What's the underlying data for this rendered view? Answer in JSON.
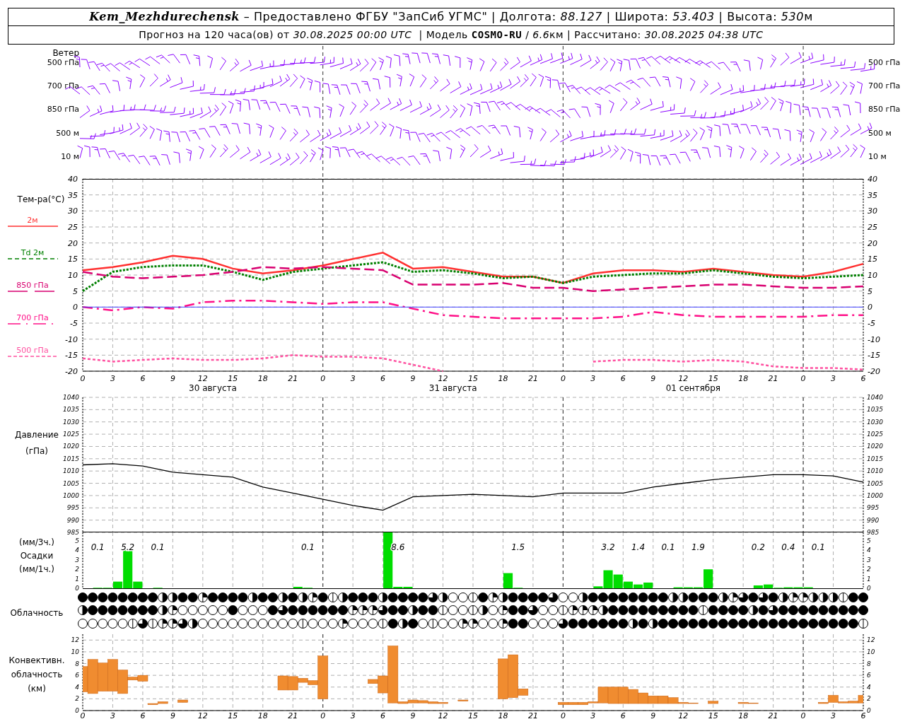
{
  "header": {
    "line_1": [
      {
        "text": "Kem_Mezhdurechensk",
        "kind": "station"
      },
      {
        "text": " – Предоставлено ФГБУ \"ЗапСиб УГМС\" | Долгота: ",
        "kind": "plain"
      },
      {
        "text": "88.127",
        "kind": "italic"
      },
      {
        "text": " | Широта: ",
        "kind": "plain"
      },
      {
        "text": "53.403",
        "kind": "italic"
      },
      {
        "text": " | Высота: ",
        "kind": "plain"
      },
      {
        "text": "530",
        "kind": "italic"
      },
      {
        "text": "м",
        "kind": "plain"
      }
    ],
    "line_2": [
      {
        "text": "Прогноз на 120 часа(ов) от ",
        "kind": "plain"
      },
      {
        "text": "30.08.2025 00:00 UTC",
        "kind": "italic"
      },
      {
        "text": "  | Модель ",
        "kind": "plain"
      },
      {
        "text": "COSMO-RU",
        "kind": "bold"
      },
      {
        "text": " / ",
        "kind": "plain"
      },
      {
        "text": "6.6",
        "kind": "italic"
      },
      {
        "text": "км | Рассчитано: ",
        "kind": "plain"
      },
      {
        "text": "30.08.2025 04:38 UTC",
        "kind": "italic"
      }
    ]
  },
  "wind": {
    "label": "Ветер",
    "levels": [
      {
        "left": "500 гПа",
        "right": "500 гПа"
      },
      {
        "left": "700 гПа",
        "right": "700 гПа"
      },
      {
        "left": "850 гПа",
        "right": "850 гПа"
      },
      {
        "left": "500 м",
        "right": "500 м"
      },
      {
        "left": "10  м",
        "right": "10  м"
      }
    ]
  },
  "temperature": {
    "chart_data": {
      "type": "line",
      "ylabel": "Тем-ра(°C)",
      "ylim": [
        -20,
        40
      ],
      "yticks": [
        40,
        35,
        30,
        25,
        20,
        15,
        10,
        5,
        0,
        -5,
        -10,
        -15,
        -20
      ],
      "grid": true,
      "categories": [
        "0",
        "3",
        "6",
        "9",
        "12",
        "15",
        "18",
        "21",
        "0",
        "3",
        "6",
        "9",
        "12",
        "15",
        "18",
        "21",
        "0",
        "3",
        "6",
        "9",
        "12",
        "15",
        "18",
        "21",
        "0",
        "3",
        "6"
      ],
      "series": [
        {
          "name": "2м",
          "color": "#ff3030",
          "line_style": "solid",
          "values": [
            11.5,
            12.5,
            14,
            16,
            15,
            12,
            10.5,
            11.5,
            13,
            15,
            17,
            12,
            12.5,
            11,
            9.5,
            9.5,
            7.5,
            10.5,
            11.5,
            11.5,
            11,
            12,
            11,
            10,
            9.5,
            11,
            13.5
          ]
        },
        {
          "name": "Td 2м",
          "color": "#008000",
          "line_style": "dotted",
          "values": [
            5,
            11,
            12.5,
            13,
            13,
            11,
            8.5,
            11,
            12,
            13,
            14,
            11,
            11.5,
            10.5,
            9,
            9.5,
            7.5,
            9.5,
            10,
            10.5,
            10.5,
            11.5,
            10.5,
            9.5,
            9,
            9.5,
            10
          ]
        },
        {
          "name": "850 гПа",
          "color": "#d80070",
          "line_style": "dashed",
          "values": [
            11,
            9.5,
            9,
            9.5,
            10,
            11,
            12.5,
            12,
            12.5,
            12,
            11.5,
            7,
            7,
            7,
            7.5,
            6,
            6,
            5,
            5.5,
            6,
            6.5,
            7,
            7,
            6.5,
            6,
            6,
            6.5
          ]
        },
        {
          "name": "700 гПа",
          "color": "#ff1088",
          "line_style": "dashdot",
          "values": [
            0,
            -1,
            0,
            -0.5,
            1.5,
            2,
            2,
            1.5,
            1,
            1.5,
            1.5,
            -0.5,
            -2.5,
            -3,
            -3.5,
            -3.5,
            -3.5,
            -3.5,
            -3,
            -1.5,
            -2.5,
            -3,
            -3,
            -3,
            -3,
            -2.5,
            -2.5
          ]
        },
        {
          "name": "500 гПа",
          "color": "#ff50a0",
          "line_style": "short_dashed",
          "values": [
            -16,
            -17,
            -16.5,
            -16,
            -16.5,
            -16.5,
            -16,
            -15,
            -15.5,
            -15.5,
            -16,
            -18,
            -20,
            null,
            null,
            null,
            null,
            -17,
            -16.5,
            -16.5,
            -17,
            -16.5,
            -17,
            -18.5,
            -19,
            -19,
            -19.5
          ]
        },
        {
          "color": "#4040ff",
          "values": [
            0,
            0,
            0,
            0,
            0,
            0,
            0,
            0,
            0,
            0,
            0,
            0,
            0,
            0,
            0,
            0,
            0,
            0,
            0,
            0,
            0,
            0,
            0,
            0,
            0,
            0,
            0
          ]
        }
      ]
    },
    "right_scale": [
      "40",
      "35",
      "30",
      "25",
      "20",
      "15",
      "10",
      "5",
      "0",
      "-5",
      "-10",
      "-15",
      "-20"
    ],
    "dates": [
      "30 августа",
      "31 августа",
      "01 сентября"
    ]
  },
  "pressure": {
    "chart_data": {
      "type": "line",
      "title": "Давление",
      "ylabel": "(гПа)",
      "ylim": [
        985,
        1040
      ],
      "yticks": [
        1040,
        1035,
        1030,
        1025,
        1020,
        1015,
        1010,
        1005,
        1000,
        995,
        990,
        985
      ],
      "grid": true,
      "categories": [
        null,
        null,
        null,
        null,
        null,
        null,
        null,
        null,
        null,
        null,
        null,
        null,
        null,
        null,
        null,
        null,
        null,
        null,
        null,
        null,
        null,
        null,
        null,
        null,
        null,
        null,
        null
      ],
      "series": [
        {
          "color": "#000000",
          "values": [
            1012.5,
            1013,
            1012,
            1009.5,
            1008.5,
            1007.5,
            1003.5,
            1001,
            998.5,
            996,
            994,
            999.5,
            1000,
            1000.5,
            1000,
            999.5,
            1001,
            1001,
            1001,
            1003.5,
            1005,
            1006.5,
            1007.5,
            1008.5,
            1008.5,
            1008,
            1005.5
          ]
        }
      ]
    },
    "right_scale": [
      "1040",
      "1035",
      "1030",
      "1025",
      "1020",
      "1015",
      "1010",
      "1005",
      "1000",
      "995",
      "990",
      "985"
    ]
  },
  "precipitation": {
    "sum_unit": "(мм/3ч.)",
    "chart_data": {
      "type": "bar",
      "title": "Осадки",
      "ylabel": "(мм/1ч.)",
      "ylim": [
        0,
        5.9
      ],
      "yticks": [
        0,
        1,
        2,
        3,
        4,
        5
      ],
      "grid": true,
      "categories": [
        null,
        null,
        null,
        null,
        null,
        null,
        null,
        null,
        null,
        null,
        null,
        null,
        null,
        null,
        null,
        null,
        null,
        null,
        null,
        null,
        null,
        null,
        null,
        null,
        null,
        null,
        null,
        null,
        null,
        null,
        null,
        null,
        null,
        null,
        null,
        null,
        null,
        null,
        null,
        null,
        null,
        null,
        null,
        null,
        null,
        null,
        null,
        null,
        null,
        null,
        null,
        null,
        null,
        null,
        null,
        null,
        null,
        null,
        null,
        null,
        null,
        null,
        null,
        null,
        null,
        null,
        null,
        null,
        null,
        null,
        null,
        null,
        null,
        null,
        null,
        null,
        null,
        null
      ],
      "series": [
        {
          "color": "#00dd00",
          "values": [
            0,
            0.05,
            0.05,
            0.7,
            4.1,
            0.7,
            0,
            0.05,
            0,
            0,
            0,
            0,
            0,
            0,
            0,
            0,
            0,
            0,
            0,
            0,
            0,
            0.15,
            0.05,
            0,
            0,
            0,
            0,
            0,
            0,
            0,
            5.9,
            0.15,
            0.15,
            0,
            0,
            0,
            0,
            0,
            0,
            0,
            0,
            0,
            1.6,
            0.05,
            0,
            0,
            0,
            0,
            0,
            0,
            0,
            0.2,
            1.9,
            1.45,
            0.7,
            0.4,
            0.6,
            0,
            0,
            0.1,
            0.1,
            0.1,
            2,
            0,
            0,
            0,
            0,
            0.3,
            0.4,
            0.05,
            0.1,
            0.1,
            0.1,
            0,
            0,
            0,
            0,
            0
          ]
        }
      ],
      "annotations": [
        "0.1",
        "5.2",
        "0.1",
        "0.1",
        "8.6",
        "1.5",
        "3.2",
        "1.4",
        "0.1",
        "1.9",
        "0.2",
        "0.4",
        "0.1"
      ]
    },
    "right_scale": [
      "5",
      "4",
      "3",
      "2",
      "1",
      "0"
    ]
  },
  "cloudiness": {
    "label": "Облачность",
    "rows": [
      {
        "cover": [
          {
            "kind": "full"
          },
          {
            "kind": "full"
          },
          {
            "kind": "full"
          },
          {
            "kind": "full"
          },
          {
            "kind": "full"
          },
          {
            "kind": "full"
          },
          {
            "kind": "full"
          },
          {
            "kind": "full"
          },
          {
            "kind": "half"
          },
          {
            "kind": "half"
          },
          {
            "kind": "full"
          },
          {
            "kind": "full"
          },
          {
            "kind": "quarter"
          },
          {
            "kind": "full"
          },
          {
            "kind": "full"
          },
          {
            "kind": "full"
          },
          {
            "kind": "full"
          },
          {
            "kind": "half"
          },
          {
            "kind": "full"
          },
          {
            "kind": "full"
          },
          {
            "kind": "half"
          },
          {
            "kind": "full"
          },
          {
            "kind": "half"
          },
          {
            "kind": "quarter"
          },
          {
            "kind": "full"
          },
          {
            "kind": "line"
          },
          {
            "kind": "half"
          },
          {
            "kind": "full"
          },
          {
            "kind": "full"
          },
          {
            "kind": "full"
          },
          {
            "kind": "half"
          },
          {
            "kind": "full"
          },
          {
            "kind": "full"
          },
          {
            "kind": "full"
          },
          {
            "kind": "full"
          },
          {
            "kind": "three"
          },
          {
            "kind": "half"
          },
          {
            "kind": "empty"
          },
          {
            "kind": "empty"
          },
          {
            "kind": "line"
          },
          {
            "kind": "full"
          },
          {
            "kind": "quarter"
          },
          {
            "kind": "half"
          },
          {
            "kind": "full"
          },
          {
            "kind": "full"
          },
          {
            "kind": "full"
          },
          {
            "kind": "full"
          },
          {
            "kind": "three"
          },
          {
            "kind": "empty"
          },
          {
            "kind": "empty"
          },
          {
            "kind": "half"
          },
          {
            "kind": "full"
          },
          {
            "kind": "full"
          },
          {
            "kind": "full"
          },
          {
            "kind": "full"
          },
          {
            "kind": "full"
          },
          {
            "kind": "full"
          },
          {
            "kind": "full"
          },
          {
            "kind": "full"
          },
          {
            "kind": "half"
          },
          {
            "kind": "half"
          },
          {
            "kind": "full"
          },
          {
            "kind": "full"
          },
          {
            "kind": "full"
          },
          {
            "kind": "half"
          },
          {
            "kind": "quarter"
          },
          {
            "kind": "three"
          },
          {
            "kind": "full"
          },
          {
            "kind": "three"
          },
          {
            "kind": "full"
          },
          {
            "kind": "half"
          },
          {
            "kind": "quarter"
          },
          {
            "kind": "quarter"
          },
          {
            "kind": "half"
          },
          {
            "kind": "half"
          },
          {
            "kind": "half"
          },
          {
            "kind": "line"
          },
          {
            "kind": "full"
          },
          {
            "kind": "full"
          }
        ]
      },
      {
        "cover": [
          {
            "kind": "half"
          },
          {
            "kind": "full"
          },
          {
            "kind": "full"
          },
          {
            "kind": "full"
          },
          {
            "kind": "full"
          },
          {
            "kind": "full"
          },
          {
            "kind": "full"
          },
          {
            "kind": "full"
          },
          {
            "kind": "half"
          },
          {
            "kind": "quarter"
          },
          {
            "kind": "empty"
          },
          {
            "kind": "empty"
          },
          {
            "kind": "empty"
          },
          {
            "kind": "empty"
          },
          {
            "kind": "empty"
          },
          {
            "kind": "full"
          },
          {
            "kind": "empty"
          },
          {
            "kind": "empty"
          },
          {
            "kind": "empty"
          },
          {
            "kind": "full"
          },
          {
            "kind": "three"
          },
          {
            "kind": "full"
          },
          {
            "kind": "full"
          },
          {
            "kind": "full"
          },
          {
            "kind": "full"
          },
          {
            "kind": "full"
          },
          {
            "kind": "full"
          },
          {
            "kind": "quarter"
          },
          {
            "kind": "quarter"
          },
          {
            "kind": "quarter"
          },
          {
            "kind": "three"
          },
          {
            "kind": "full"
          },
          {
            "kind": "full"
          },
          {
            "kind": "half"
          },
          {
            "kind": "full"
          },
          {
            "kind": "full"
          },
          {
            "kind": "line"
          },
          {
            "kind": "empty"
          },
          {
            "kind": "empty"
          },
          {
            "kind": "line"
          },
          {
            "kind": "half"
          },
          {
            "kind": "empty"
          },
          {
            "kind": "quarter"
          },
          {
            "kind": "full"
          },
          {
            "kind": "full"
          },
          {
            "kind": "three"
          },
          {
            "kind": "empty"
          },
          {
            "kind": "empty"
          },
          {
            "kind": "line"
          },
          {
            "kind": "quarter"
          },
          {
            "kind": "quarter"
          },
          {
            "kind": "quarter"
          },
          {
            "kind": "half"
          },
          {
            "kind": "full"
          },
          {
            "kind": "full"
          },
          {
            "kind": "full"
          },
          {
            "kind": "full"
          },
          {
            "kind": "full"
          },
          {
            "kind": "full"
          },
          {
            "kind": "full"
          },
          {
            "kind": "full"
          },
          {
            "kind": "full"
          },
          {
            "kind": "line"
          },
          {
            "kind": "full"
          },
          {
            "kind": "full"
          },
          {
            "kind": "full"
          },
          {
            "kind": "full"
          },
          {
            "kind": "half"
          },
          {
            "kind": "full"
          },
          {
            "kind": "three"
          },
          {
            "kind": "full"
          },
          {
            "kind": "full"
          },
          {
            "kind": "full"
          },
          {
            "kind": "full"
          },
          {
            "kind": "full"
          },
          {
            "kind": "full"
          },
          {
            "kind": "full"
          },
          {
            "kind": "full"
          },
          {
            "kind": "full"
          }
        ]
      },
      {
        "cover": [
          {
            "kind": "empty"
          },
          {
            "kind": "empty"
          },
          {
            "kind": "empty"
          },
          {
            "kind": "empty"
          },
          {
            "kind": "empty"
          },
          {
            "kind": "line"
          },
          {
            "kind": "three"
          },
          {
            "kind": "line"
          },
          {
            "kind": "quarter"
          },
          {
            "kind": "quarter"
          },
          {
            "kind": "three"
          },
          {
            "kind": "half"
          },
          {
            "kind": "empty"
          },
          {
            "kind": "empty"
          },
          {
            "kind": "empty"
          },
          {
            "kind": "empty"
          },
          {
            "kind": "empty"
          },
          {
            "kind": "empty"
          },
          {
            "kind": "empty"
          },
          {
            "kind": "empty"
          },
          {
            "kind": "empty"
          },
          {
            "kind": "empty"
          },
          {
            "kind": "line"
          },
          {
            "kind": "empty"
          },
          {
            "kind": "empty"
          },
          {
            "kind": "empty"
          },
          {
            "kind": "quarter"
          },
          {
            "kind": "empty"
          },
          {
            "kind": "empty"
          },
          {
            "kind": "empty"
          },
          {
            "kind": "line"
          },
          {
            "kind": "full"
          },
          {
            "kind": "half"
          },
          {
            "kind": "full"
          },
          {
            "kind": "empty"
          },
          {
            "kind": "line"
          },
          {
            "kind": "empty"
          },
          {
            "kind": "empty"
          },
          {
            "kind": "quarter"
          },
          {
            "kind": "quarter"
          },
          {
            "kind": "empty"
          },
          {
            "kind": "empty"
          },
          {
            "kind": "quarter"
          },
          {
            "kind": "full"
          },
          {
            "kind": "full"
          },
          {
            "kind": "empty"
          },
          {
            "kind": "empty"
          },
          {
            "kind": "empty"
          },
          {
            "kind": "three"
          },
          {
            "kind": "full"
          },
          {
            "kind": "full"
          },
          {
            "kind": "full"
          },
          {
            "kind": "full"
          },
          {
            "kind": "full"
          },
          {
            "kind": "full"
          },
          {
            "kind": "half"
          },
          {
            "kind": "full"
          },
          {
            "kind": "half"
          },
          {
            "kind": "full"
          },
          {
            "kind": "full"
          },
          {
            "kind": "full"
          },
          {
            "kind": "full"
          },
          {
            "kind": "full"
          },
          {
            "kind": "full"
          },
          {
            "kind": "full"
          },
          {
            "kind": "full"
          },
          {
            "kind": "full"
          },
          {
            "kind": "full"
          },
          {
            "kind": "full"
          },
          {
            "kind": "full"
          },
          {
            "kind": "full"
          },
          {
            "kind": "full"
          },
          {
            "kind": "full"
          },
          {
            "kind": "full"
          },
          {
            "kind": "full"
          },
          {
            "kind": "full"
          },
          {
            "kind": "full"
          },
          {
            "kind": "full"
          },
          {
            "kind": "line"
          }
        ]
      }
    ]
  },
  "convective": {
    "label_lines": [
      "Конвективн.",
      "облачность"
    ],
    "chart_data": {
      "type": "candlestick",
      "ylabel": "(км)",
      "ylim": [
        0,
        13
      ],
      "yticks": [
        0,
        2,
        4,
        6,
        8,
        10,
        12
      ],
      "grid": true,
      "categories": [
        "0",
        null,
        null,
        "3",
        null,
        null,
        "6",
        null,
        null,
        "9",
        null,
        null,
        "12",
        null,
        null,
        "15",
        null,
        null,
        "18",
        null,
        null,
        "21",
        null,
        null,
        "0",
        null,
        null,
        "3",
        null,
        null,
        "6",
        null,
        null,
        "9",
        null,
        null,
        "12",
        null,
        null,
        "15",
        null,
        null,
        "18",
        null,
        null,
        "21",
        null,
        null,
        "0",
        null,
        null,
        "3",
        null,
        null,
        "6",
        null,
        null,
        "9",
        null,
        null,
        "12",
        null,
        null,
        "15",
        null,
        null,
        "18",
        null,
        null,
        "21",
        null,
        null,
        "0",
        null,
        null,
        "3",
        null,
        null,
        "6"
      ],
      "series": [
        {
          "color": "#f08c30",
          "ohlc": [
            [
              3.2,
              7.5,
              3.2,
              7.5
            ],
            [
              2.9,
              8.7,
              2.9,
              8.7
            ],
            [
              3.3,
              8.1,
              3.3,
              8.1
            ],
            [
              3.3,
              8.7,
              3.3,
              8.7
            ],
            [
              2.9,
              6.9,
              2.9,
              6.9
            ],
            [
              5.2,
              5.7,
              5.2,
              5.7
            ],
            [
              5,
              6,
              5,
              6
            ],
            [
              1,
              1.2,
              1,
              1.2
            ],
            [
              1.2,
              1.5,
              1.2,
              1.5
            ],
            null,
            [
              1.4,
              1.8,
              1.4,
              1.8
            ],
            null,
            null,
            null,
            null,
            null,
            null,
            null,
            null,
            null,
            [
              3.5,
              5.9,
              3.5,
              5.9
            ],
            [
              3.5,
              5.8,
              3.5,
              5.8
            ],
            [
              4.8,
              5.5,
              4.8,
              5.5
            ],
            [
              4.4,
              5.1,
              4.4,
              5.1
            ],
            [
              2,
              9.3,
              2,
              9.3
            ],
            null,
            null,
            null,
            null,
            [
              4.6,
              5.3,
              4.6,
              5.3
            ],
            [
              3,
              5.9,
              3,
              5.9
            ],
            [
              1.3,
              11,
              1.3,
              11
            ],
            [
              1.2,
              1.5,
              1.2,
              1.5
            ],
            [
              1.3,
              1.8,
              1.3,
              1.8
            ],
            [
              1.3,
              1.7,
              1.3,
              1.7
            ],
            [
              1.2,
              1.5,
              1.2,
              1.5
            ],
            [
              1.2,
              1.4,
              1.2,
              1.4
            ],
            null,
            [
              1.6,
              1.8,
              1.6,
              1.8
            ],
            null,
            null,
            null,
            [
              2,
              8.8,
              2,
              8.8
            ],
            [
              2.2,
              9.5,
              2.2,
              9.5
            ],
            [
              2.6,
              3.7,
              2.6,
              3.7
            ],
            null,
            null,
            null,
            [
              1,
              1.4,
              1,
              1.4
            ],
            [
              1,
              1.4,
              1,
              1.4
            ],
            [
              1,
              1.4,
              1,
              1.4
            ],
            [
              1.3,
              1.5,
              1.3,
              1.5
            ],
            [
              1.3,
              4,
              1.3,
              4
            ],
            [
              1.2,
              4,
              1.2,
              4
            ],
            [
              1.2,
              4,
              1.2,
              4
            ],
            [
              1.2,
              3.6,
              1.2,
              3.6
            ],
            [
              1.2,
              3,
              1.2,
              3
            ],
            [
              1.2,
              2.5,
              1.2,
              2.5
            ],
            [
              1.2,
              2.5,
              1.2,
              2.5
            ],
            [
              1.2,
              2.2,
              1.2,
              2.2
            ],
            [
              1.2,
              1.4,
              1.2,
              1.4
            ],
            [
              1.2,
              1.3,
              1.2,
              1.3
            ],
            null,
            [
              1.2,
              1.6,
              1.2,
              1.6
            ],
            null,
            null,
            [
              1.2,
              1.4,
              1.2,
              1.4
            ],
            [
              1.2,
              1.3,
              1.2,
              1.3
            ],
            null,
            null,
            null,
            null,
            null,
            null,
            [
              1.2,
              1.4,
              1.2,
              1.4
            ],
            [
              1.4,
              2.6,
              1.4,
              2.6
            ],
            [
              1.3,
              1.5,
              1.3,
              1.5
            ],
            [
              1.3,
              1.6,
              1.3,
              1.6
            ],
            [
              1.3,
              2.6,
              1.3,
              2.6
            ]
          ]
        }
      ]
    },
    "right_scale": [
      "12",
      "10",
      "8",
      "6",
      "4",
      "2",
      "0"
    ]
  }
}
